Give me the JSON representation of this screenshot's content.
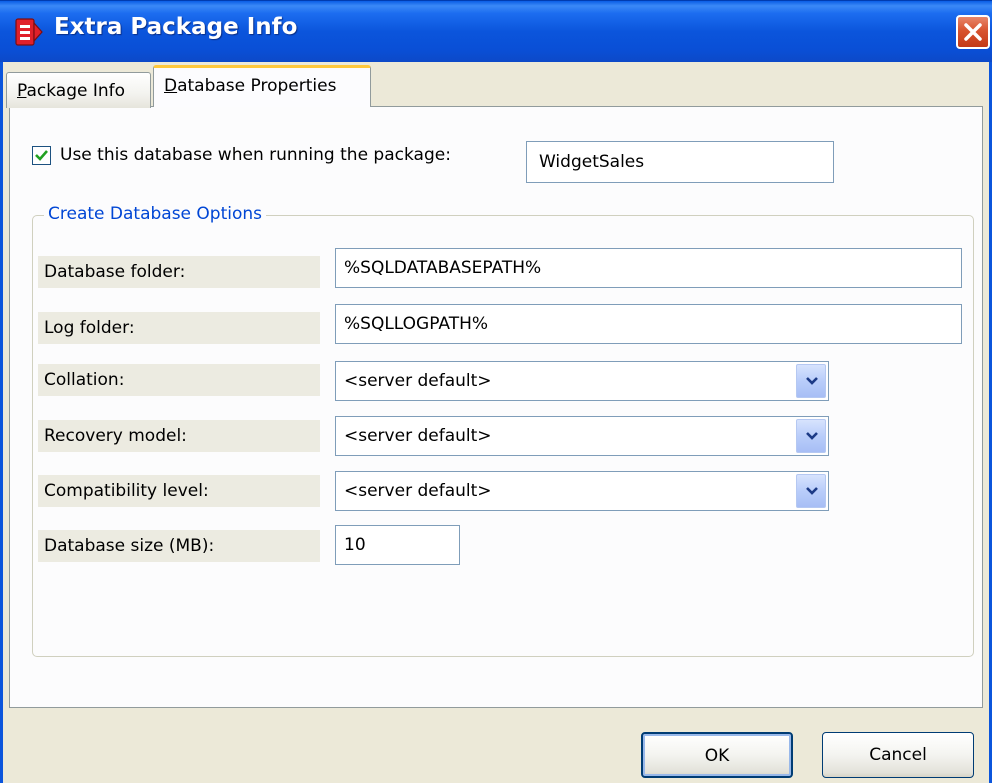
{
  "window": {
    "title": "Extra Package Info",
    "icon": "app-red-icon",
    "close_icon": "close-icon"
  },
  "tabs": [
    {
      "label_underlined": "P",
      "label_rest": "ackage Info",
      "active": false
    },
    {
      "label_underlined": "D",
      "label_rest": "atabase Properties",
      "active": true
    }
  ],
  "use_database": {
    "checked": true,
    "label": "Use this database when running the package:",
    "value": "WidgetSales"
  },
  "create_options": {
    "legend": "Create Database Options",
    "database_folder": {
      "label": "Database folder:",
      "value": "%SQLDATABASEPATH%"
    },
    "log_folder": {
      "label": "Log folder:",
      "value": "%SQLLOGPATH%"
    },
    "collation": {
      "label": "Collation:",
      "value": "<server default>"
    },
    "recovery_model": {
      "label": "Recovery model:",
      "value": "<server default>"
    },
    "compatibility_level": {
      "label": "Compatibility level:",
      "value": "<server default>"
    },
    "database_size": {
      "label": "Database size (MB):",
      "value": "10"
    }
  },
  "buttons": {
    "ok": "OK",
    "cancel": "Cancel"
  },
  "colors": {
    "titlebar": "#0b55dc",
    "legend_text": "#0046d5",
    "close": "#d8532e",
    "active_tab_accent": "#ffc83c"
  }
}
